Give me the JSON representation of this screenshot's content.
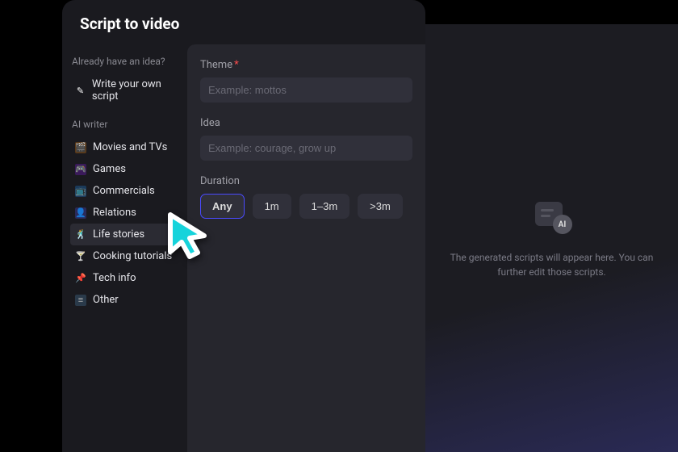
{
  "header": {
    "title": "Script to video"
  },
  "sidebar": {
    "ideaPrompt": "Already have an idea?",
    "writeOwn": "Write your own script",
    "aiWriterLabel": "AI writer",
    "items": [
      {
        "label": "Movies and TVs"
      },
      {
        "label": "Games"
      },
      {
        "label": "Commercials"
      },
      {
        "label": "Relations"
      },
      {
        "label": "Life stories"
      },
      {
        "label": "Cooking tutorials"
      },
      {
        "label": "Tech info"
      },
      {
        "label": "Other"
      }
    ]
  },
  "form": {
    "themeLabel": "Theme",
    "themePlaceholder": "Example: mottos",
    "ideaLabel": "Idea",
    "ideaPlaceholder": "Example: courage, grow up",
    "durationLabel": "Duration",
    "durations": [
      "Any",
      "1m",
      "1–3m",
      ">3m"
    ],
    "durationSelected": "Any"
  },
  "preview": {
    "aiBadge": "AI",
    "emptyText": "The generated scripts will appear here. You can further edit those scripts."
  }
}
